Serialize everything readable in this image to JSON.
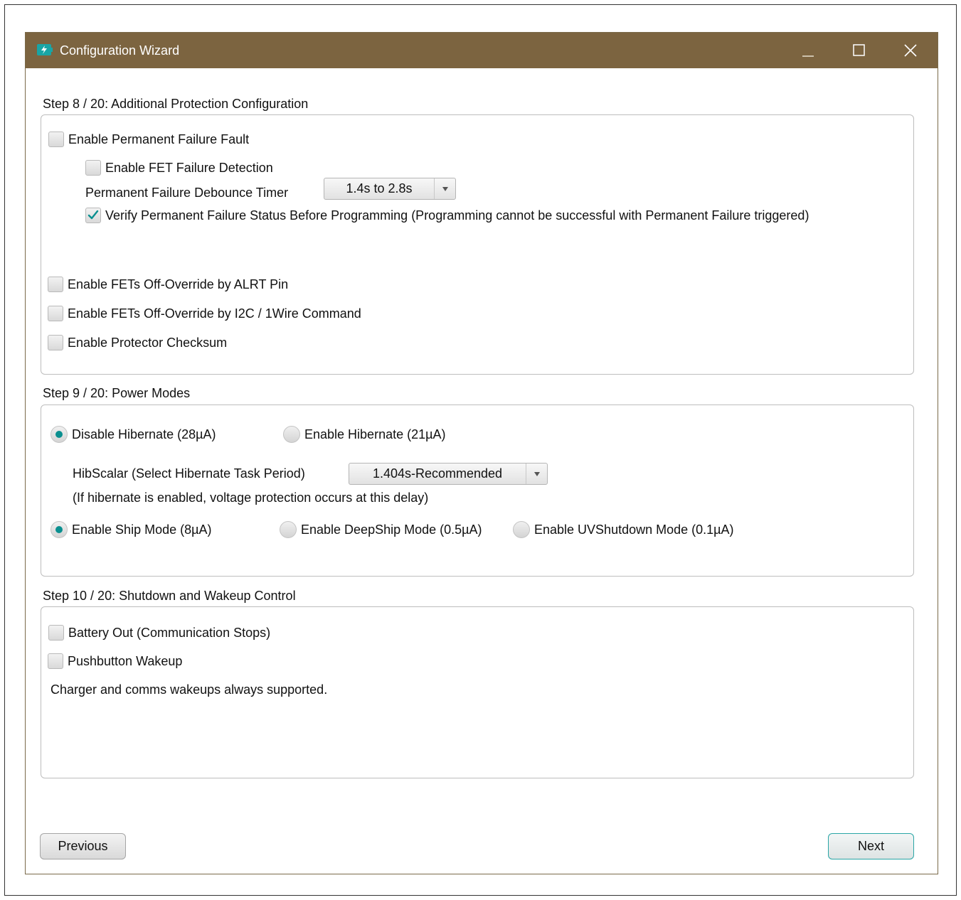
{
  "window": {
    "title": "Configuration Wizard",
    "titlebar_color": "#7c6440",
    "accent_color": "#0a8f8f"
  },
  "step8": {
    "label": "Step 8 / 20: Additional Protection Configuration",
    "permanent_failure": {
      "label": "Enable Permanent Failure Fault",
      "checked": false
    },
    "fet_failure": {
      "label": "Enable FET Failure Detection",
      "checked": false
    },
    "debounce_timer": {
      "label": "Permanent Failure Debounce Timer",
      "value": "1.4s to 2.8s"
    },
    "verify_status": {
      "label": "Verify Permanent Failure Status Before Programming (Programming cannot be successful with Permanent Failure triggered)",
      "checked": true
    },
    "alrt_override": {
      "label": "Enable FETs Off-Override by ALRT Pin",
      "checked": false
    },
    "i2c_override": {
      "label": "Enable FETs Off-Override by I2C / 1Wire Command",
      "checked": false
    },
    "protector_checksum": {
      "label": "Enable Protector Checksum",
      "checked": false
    }
  },
  "step9": {
    "label": "Step 9 / 20: Power Modes",
    "disable_hibernate": {
      "label": "Disable Hibernate (28µA)",
      "selected": true
    },
    "enable_hibernate": {
      "label": "Enable Hibernate (21µA)",
      "selected": false
    },
    "hibscalar": {
      "label": "HibScalar (Select Hibernate Task Period)",
      "value": "1.404s-Recommended"
    },
    "hibernate_note": "(If hibernate is enabled, voltage protection occurs at this delay)",
    "ship_mode": {
      "label": "Enable Ship Mode (8µA)",
      "selected": true
    },
    "deepship_mode": {
      "label": "Enable DeepShip Mode (0.5µA)",
      "selected": false
    },
    "uvshutdown_mode": {
      "label": "Enable UVShutdown Mode (0.1µA)",
      "selected": false
    }
  },
  "step10": {
    "label": "Step 10 / 20: Shutdown and Wakeup Control",
    "battery_out": {
      "label": "Battery Out (Communication Stops)",
      "checked": false
    },
    "pushbutton_wakeup": {
      "label": "Pushbutton Wakeup",
      "checked": false
    },
    "note": "Charger and comms wakeups always supported."
  },
  "buttons": {
    "previous": "Previous",
    "next": "Next"
  }
}
